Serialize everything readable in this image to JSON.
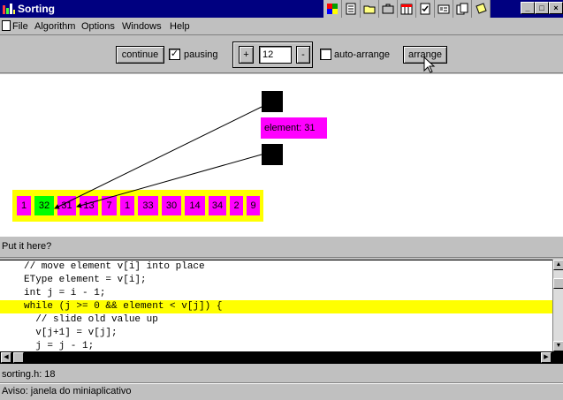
{
  "window": {
    "title": "Sorting",
    "minimize": "_",
    "maximize": "□",
    "close": "×"
  },
  "tray": {
    "icons": [
      "flag-icon",
      "notepad-icon",
      "folder-icon",
      "briefcase-icon",
      "calendar-icon",
      "checklist-icon",
      "card-icon",
      "docs-icon",
      "note-icon"
    ]
  },
  "menu": {
    "items": [
      "File",
      "Algorithm",
      "Options",
      "Windows",
      "Help"
    ]
  },
  "toolbar": {
    "continue_label": "continue",
    "pausing_checked": "✓",
    "pausing_label": "pausing",
    "plus_label": "+",
    "step_value": "12",
    "minus_label": "-",
    "auto_arrange_checked": "",
    "auto_arrange_label": "auto-arrange",
    "arrange_label": "arrange"
  },
  "visual": {
    "element_label": "element: 31",
    "array": [
      {
        "value": "1",
        "active": false
      },
      {
        "value": "32",
        "active": true
      },
      {
        "value": "31",
        "active": false
      },
      {
        "value": "13",
        "active": false
      },
      {
        "value": "7",
        "active": false
      },
      {
        "value": "1",
        "active": false
      },
      {
        "value": "33",
        "active": false
      },
      {
        "value": "30",
        "active": false
      },
      {
        "value": "14",
        "active": false
      },
      {
        "value": "34",
        "active": false
      },
      {
        "value": "2",
        "active": false
      },
      {
        "value": "9",
        "active": false
      }
    ],
    "colors": {
      "cell": "#ff00ff",
      "active_cell": "#00ff00",
      "frame": "#ffff00",
      "highlight": "#ffff00"
    }
  },
  "prompt": {
    "text": "Put it here?"
  },
  "code": {
    "lines": [
      {
        "text": "// move element v[i] into place",
        "highlight": false
      },
      {
        "text": "EType element = v[i];",
        "highlight": false
      },
      {
        "text": "int j = i - 1;",
        "highlight": false
      },
      {
        "text": "while (j >= 0 && element < v[j]) {",
        "highlight": true
      },
      {
        "text": "  // slide old value up",
        "highlight": false
      },
      {
        "text": "  v[j+1] = v[j];",
        "highlight": false
      },
      {
        "text": "  j = j - 1;",
        "highlight": false
      }
    ]
  },
  "status": {
    "file_line": "sorting.h: 18",
    "applet_note": "Aviso: janela do miniaplicativo"
  }
}
